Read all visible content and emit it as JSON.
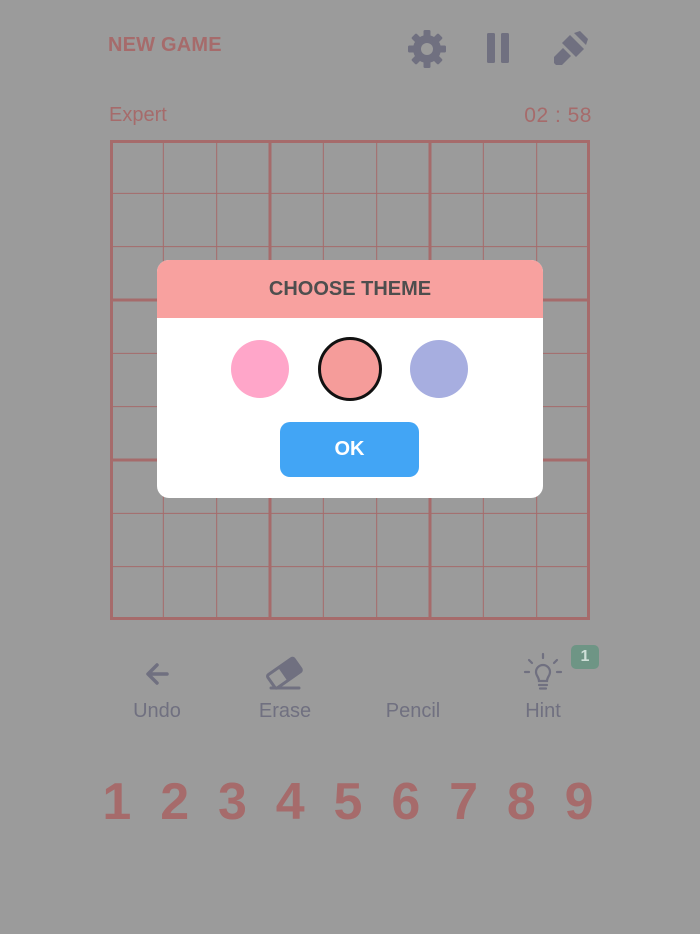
{
  "header": {
    "new_game_label": "NEW GAME",
    "icons": [
      "gear-icon",
      "pause-icon",
      "theme-brush-icon"
    ]
  },
  "status": {
    "difficulty": "Expert",
    "timer": "02 : 58"
  },
  "toolbar": {
    "undo_label": "Undo",
    "erase_label": "Erase",
    "pencil_label": "Pencil",
    "hint_label": "Hint",
    "hint_count": "1"
  },
  "numpad": {
    "digits": [
      "1",
      "2",
      "3",
      "4",
      "5",
      "6",
      "7",
      "8",
      "9"
    ]
  },
  "dialog": {
    "title": "CHOOSE THEME",
    "ok_label": "OK",
    "themes": [
      {
        "color": "#ffa6c9",
        "selected": false
      },
      {
        "color": "#f59c9a",
        "selected": true
      },
      {
        "color": "#a7aee0",
        "selected": false
      }
    ]
  },
  "colors": {
    "overlay_background": "#9b9b9b",
    "accent_dim": "#a66b6b",
    "icon_dim": "#707080",
    "dialog_header": "#f8a19f",
    "ok_button": "#42a5f5",
    "hint_badge": "#6e9585"
  }
}
